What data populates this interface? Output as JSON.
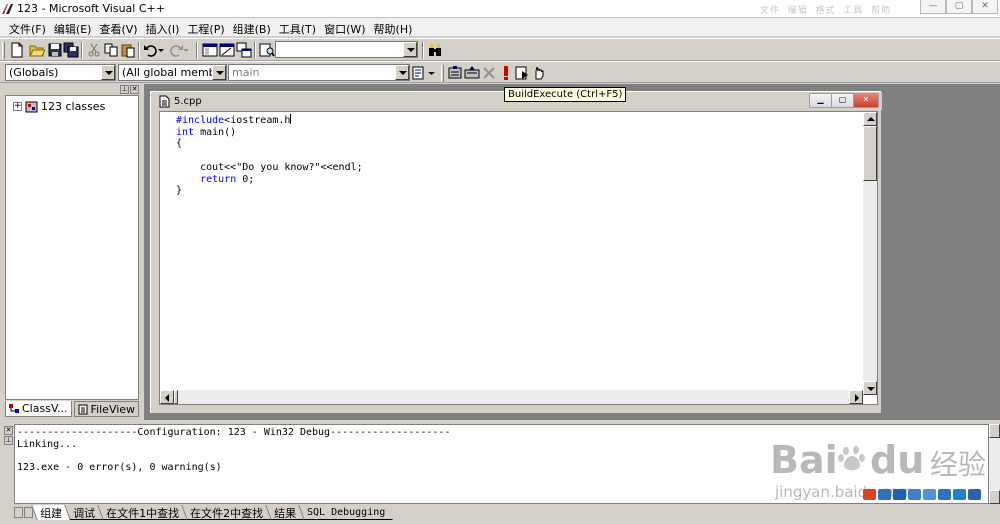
{
  "window": {
    "title": "123 - Microsoft Visual C++",
    "faded_labels": [
      "文件",
      "编辑",
      "格式",
      "工具",
      "帮助"
    ]
  },
  "menu": [
    "文件(F)",
    "编辑(E)",
    "查看(V)",
    "插入(I)",
    "工程(P)",
    "组建(B)",
    "工具(T)",
    "窗口(W)",
    "帮助(H)"
  ],
  "toolbar": {
    "find_value": "",
    "class_combo": "(Globals)",
    "members_combo": "(All global members",
    "function_combo": "main"
  },
  "tooltip": "BuildExecute (Ctrl+F5)",
  "workspace": {
    "tree_root": "123 classes",
    "tabs": [
      "ClassV...",
      "FileView"
    ]
  },
  "editor": {
    "title": "5.cpp",
    "lines": [
      "#include<iostream.h",
      "int main()",
      "{",
      "",
      "    cout<<\"Do you know?\"<<endl;",
      "    return 0;",
      "}"
    ]
  },
  "output": {
    "lines": [
      "--------------------Configuration: 123 - Win32 Debug--------------------",
      "Linking...",
      "",
      "123.exe - 0 error(s), 0 warning(s)"
    ],
    "tabs": [
      "组建",
      "调试",
      "在文件1中查找",
      "在文件2中查找",
      "结果",
      "SQL Debugging"
    ]
  },
  "watermark": {
    "brand": "Bai",
    "brand2": "du",
    "cn": "经验",
    "url": "jingyan.baidu.com"
  },
  "colors": {
    "keyword": "#0000ff",
    "background": "#d4d0c8",
    "tooltip_bg": "#ffffe1",
    "close_button": "#c84030"
  }
}
